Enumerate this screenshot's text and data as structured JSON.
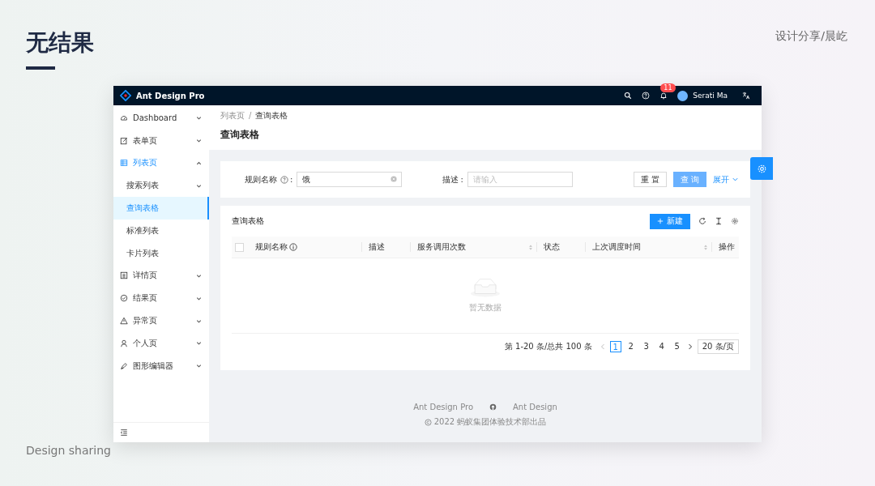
{
  "slide": {
    "title": "无结果",
    "brand": "设计分享/晨屹",
    "footer": "Design sharing"
  },
  "header": {
    "logo_text": "Ant Design Pro",
    "notification_count": "11",
    "user_name": "Serati Ma"
  },
  "sidebar": {
    "items": [
      {
        "label": "Dashboard",
        "kind": "group",
        "expanded": false,
        "selected": false
      },
      {
        "label": "表单页",
        "kind": "group",
        "expanded": false,
        "selected": false
      },
      {
        "label": "列表页",
        "kind": "group",
        "expanded": true,
        "selected": true,
        "children": [
          {
            "label": "搜索列表",
            "kind": "group",
            "expanded": false,
            "selected": false
          },
          {
            "label": "查询表格",
            "kind": "item",
            "selected": true
          },
          {
            "label": "标准列表",
            "kind": "item",
            "selected": false
          },
          {
            "label": "卡片列表",
            "kind": "item",
            "selected": false
          }
        ]
      },
      {
        "label": "详情页",
        "kind": "group",
        "expanded": false,
        "selected": false
      },
      {
        "label": "结果页",
        "kind": "group",
        "expanded": false,
        "selected": false
      },
      {
        "label": "异常页",
        "kind": "group",
        "expanded": false,
        "selected": false
      },
      {
        "label": "个人页",
        "kind": "group",
        "expanded": false,
        "selected": false
      },
      {
        "label": "图形编辑器",
        "kind": "group",
        "expanded": false,
        "selected": false
      }
    ]
  },
  "breadcrumb": [
    "列表页",
    "查询表格"
  ],
  "breadcrumb_separator": "/",
  "page_title": "查询表格",
  "search": {
    "fields": [
      {
        "label": "规则名称",
        "help": true,
        "colon": ":",
        "value": "饿"
      },
      {
        "label": "描述",
        "help": false,
        "colon": ":",
        "placeholder": "请输入"
      }
    ],
    "reset": "重 置",
    "submit": "查 询",
    "expand": "展开"
  },
  "table": {
    "title": "查询表格",
    "new_button": "新建",
    "select_all": {
      "checked": false
    },
    "columns": [
      {
        "label": "规则名称",
        "kind": "info"
      },
      {
        "label": "描述",
        "kind": "plain"
      },
      {
        "label": "服务调用次数",
        "kind": "sortable"
      },
      {
        "label": "状态",
        "kind": "plain"
      },
      {
        "label": "上次调度时间",
        "kind": "sortable"
      },
      {
        "label": "操作",
        "kind": "plain"
      }
    ],
    "empty_text": "暂无数据",
    "pagination": {
      "summary": "第 1-20 条/总共 100 条",
      "pages": [
        {
          "label": "1",
          "selected": true
        },
        {
          "label": "2",
          "selected": false
        },
        {
          "label": "3",
          "selected": false
        },
        {
          "label": "4",
          "selected": false
        },
        {
          "label": "5",
          "selected": false
        }
      ],
      "page_size": "20 条/页"
    }
  },
  "footer": {
    "links": [
      "Ant Design Pro",
      "Ant Design"
    ],
    "copyright": "2022 蚂蚁集团体验技术部出品"
  }
}
